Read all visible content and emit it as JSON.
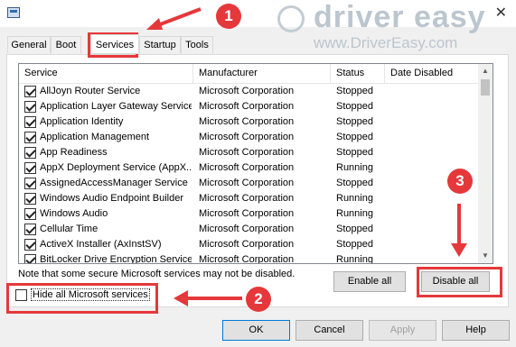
{
  "window": {
    "close_glyph": "✕",
    "icon": "msconfig-icon"
  },
  "watermark": {
    "brand": "driver easy",
    "url": "www.DriverEasy.com"
  },
  "tabs": [
    {
      "label": "General"
    },
    {
      "label": "Boot"
    },
    {
      "label": "Services",
      "active": true
    },
    {
      "label": "Startup"
    },
    {
      "label": "Tools"
    }
  ],
  "columns": {
    "service": "Service",
    "manufacturer": "Manufacturer",
    "status": "Status",
    "date_disabled": "Date Disabled"
  },
  "services": [
    {
      "name": "AllJoyn Router Service",
      "manufacturer": "Microsoft Corporation",
      "status": "Stopped",
      "checked": true
    },
    {
      "name": "Application Layer Gateway Service",
      "manufacturer": "Microsoft Corporation",
      "status": "Stopped",
      "checked": true
    },
    {
      "name": "Application Identity",
      "manufacturer": "Microsoft Corporation",
      "status": "Stopped",
      "checked": true
    },
    {
      "name": "Application Management",
      "manufacturer": "Microsoft Corporation",
      "status": "Stopped",
      "checked": true
    },
    {
      "name": "App Readiness",
      "manufacturer": "Microsoft Corporation",
      "status": "Stopped",
      "checked": true
    },
    {
      "name": "AppX Deployment Service (AppX...",
      "manufacturer": "Microsoft Corporation",
      "status": "Running",
      "checked": true
    },
    {
      "name": "AssignedAccessManager Service",
      "manufacturer": "Microsoft Corporation",
      "status": "Stopped",
      "checked": true
    },
    {
      "name": "Windows Audio Endpoint Builder",
      "manufacturer": "Microsoft Corporation",
      "status": "Running",
      "checked": true
    },
    {
      "name": "Windows Audio",
      "manufacturer": "Microsoft Corporation",
      "status": "Running",
      "checked": true
    },
    {
      "name": "Cellular Time",
      "manufacturer": "Microsoft Corporation",
      "status": "Stopped",
      "checked": true
    },
    {
      "name": "ActiveX Installer (AxInstSV)",
      "manufacturer": "Microsoft Corporation",
      "status": "Stopped",
      "checked": true
    },
    {
      "name": "BitLocker Drive Encryption Service",
      "manufacturer": "Microsoft Corporation",
      "status": "Running",
      "checked": true
    }
  ],
  "note": "Note that some secure Microsoft services may not be disabled.",
  "buttons": {
    "enable_all": "Enable all",
    "disable_all": "Disable all",
    "ok": "OK",
    "cancel": "Cancel",
    "apply": "Apply",
    "help": "Help"
  },
  "hide_ms_services": {
    "label": "Hide all Microsoft services",
    "checked": false
  },
  "annotations": {
    "step1": "1",
    "step2": "2",
    "step3": "3",
    "color": "#e5383b"
  }
}
